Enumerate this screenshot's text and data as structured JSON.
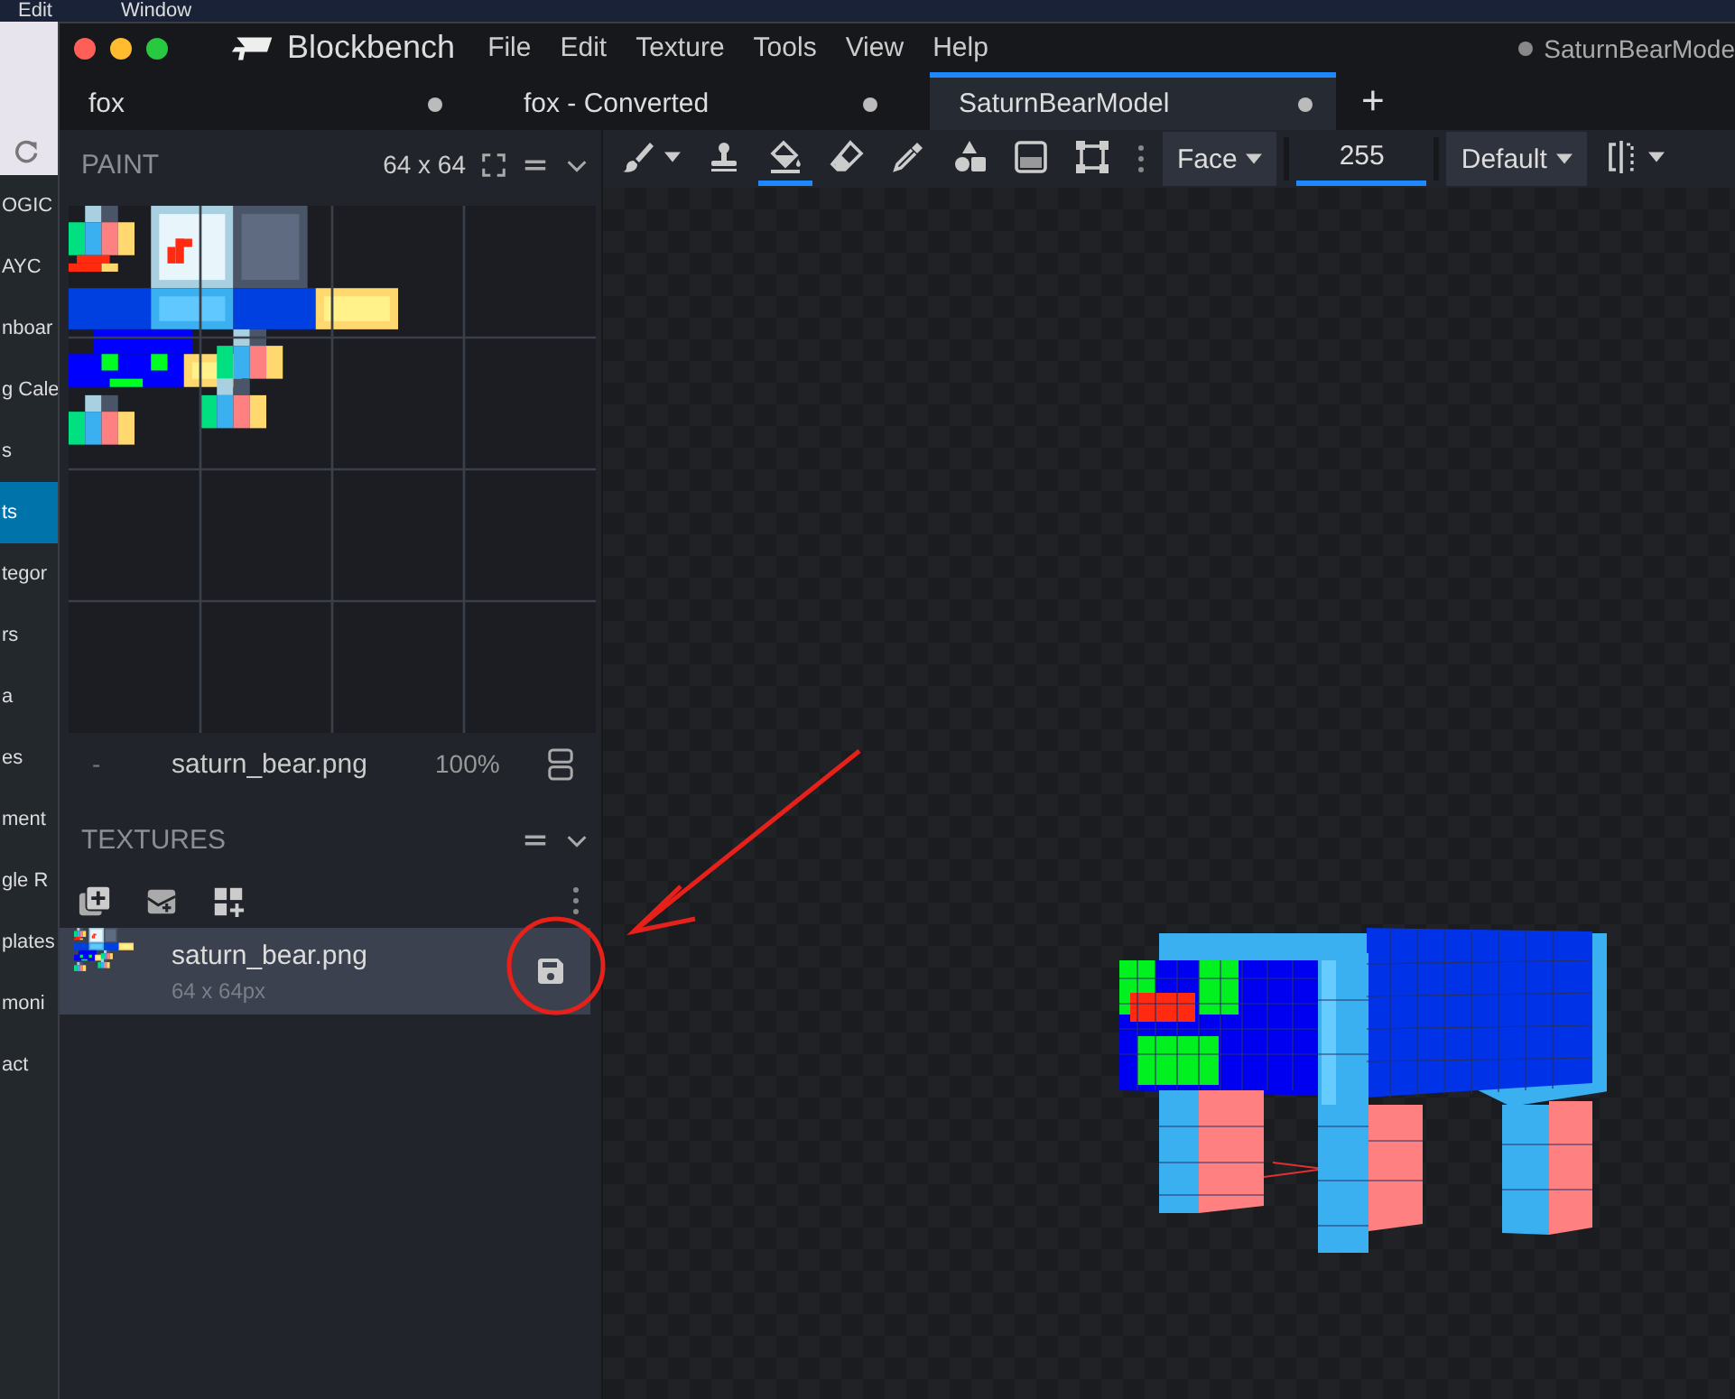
{
  "os_menu": [
    "Edit",
    "Window"
  ],
  "background_app": {
    "items": [
      {
        "label": "OGIC",
        "selected": false
      },
      {
        "label": "AYC",
        "selected": false
      },
      {
        "label": "nboar",
        "selected": false
      },
      {
        "label": "g Cale",
        "selected": false
      },
      {
        "label": "s",
        "selected": false
      },
      {
        "label": "ts",
        "selected": true
      },
      {
        "label": "tegor",
        "selected": false
      },
      {
        "label": "rs",
        "selected": false
      },
      {
        "label": "a",
        "selected": false
      },
      {
        "label": "es",
        "selected": false
      },
      {
        "label": "ment",
        "selected": false
      },
      {
        "label": "gle R",
        "selected": false
      },
      {
        "label": "plates",
        "selected": false
      },
      {
        "label": "moni",
        "selected": false
      },
      {
        "label": "act",
        "selected": false
      }
    ]
  },
  "window": {
    "title": "Blockbench",
    "menus": [
      "File",
      "Edit",
      "Texture",
      "Tools",
      "View",
      "Help"
    ],
    "project_title": "SaturnBearMode",
    "project_unsaved": true
  },
  "tabs": [
    {
      "label": "fox",
      "selected": false,
      "unsaved": true
    },
    {
      "label": "fox - Converted",
      "selected": false,
      "unsaved": true
    },
    {
      "label": "SaturnBearModel",
      "selected": true,
      "unsaved": true
    }
  ],
  "new_tab": "+",
  "paint_panel": {
    "title": "PAINT",
    "size": "64 x 64",
    "left_label": "-",
    "file": "saturn_bear.png",
    "zoom": "100%"
  },
  "toolbar": {
    "tools": [
      {
        "kind": "brush",
        "selected": false
      },
      {
        "kind": "stamp",
        "selected": false
      },
      {
        "kind": "fill",
        "selected": true
      },
      {
        "kind": "eraser",
        "selected": false
      },
      {
        "kind": "picker",
        "selected": false
      },
      {
        "kind": "shapes",
        "selected": false
      },
      {
        "kind": "gradient",
        "selected": false
      },
      {
        "kind": "transform",
        "selected": false
      }
    ],
    "mode": "Face",
    "opacity": "255",
    "blend": "Default"
  },
  "textures_panel": {
    "title": "TEXTURES",
    "items": [
      {
        "name": "saturn_bear.png",
        "size": "64 x 64px",
        "selected": true
      }
    ]
  }
}
